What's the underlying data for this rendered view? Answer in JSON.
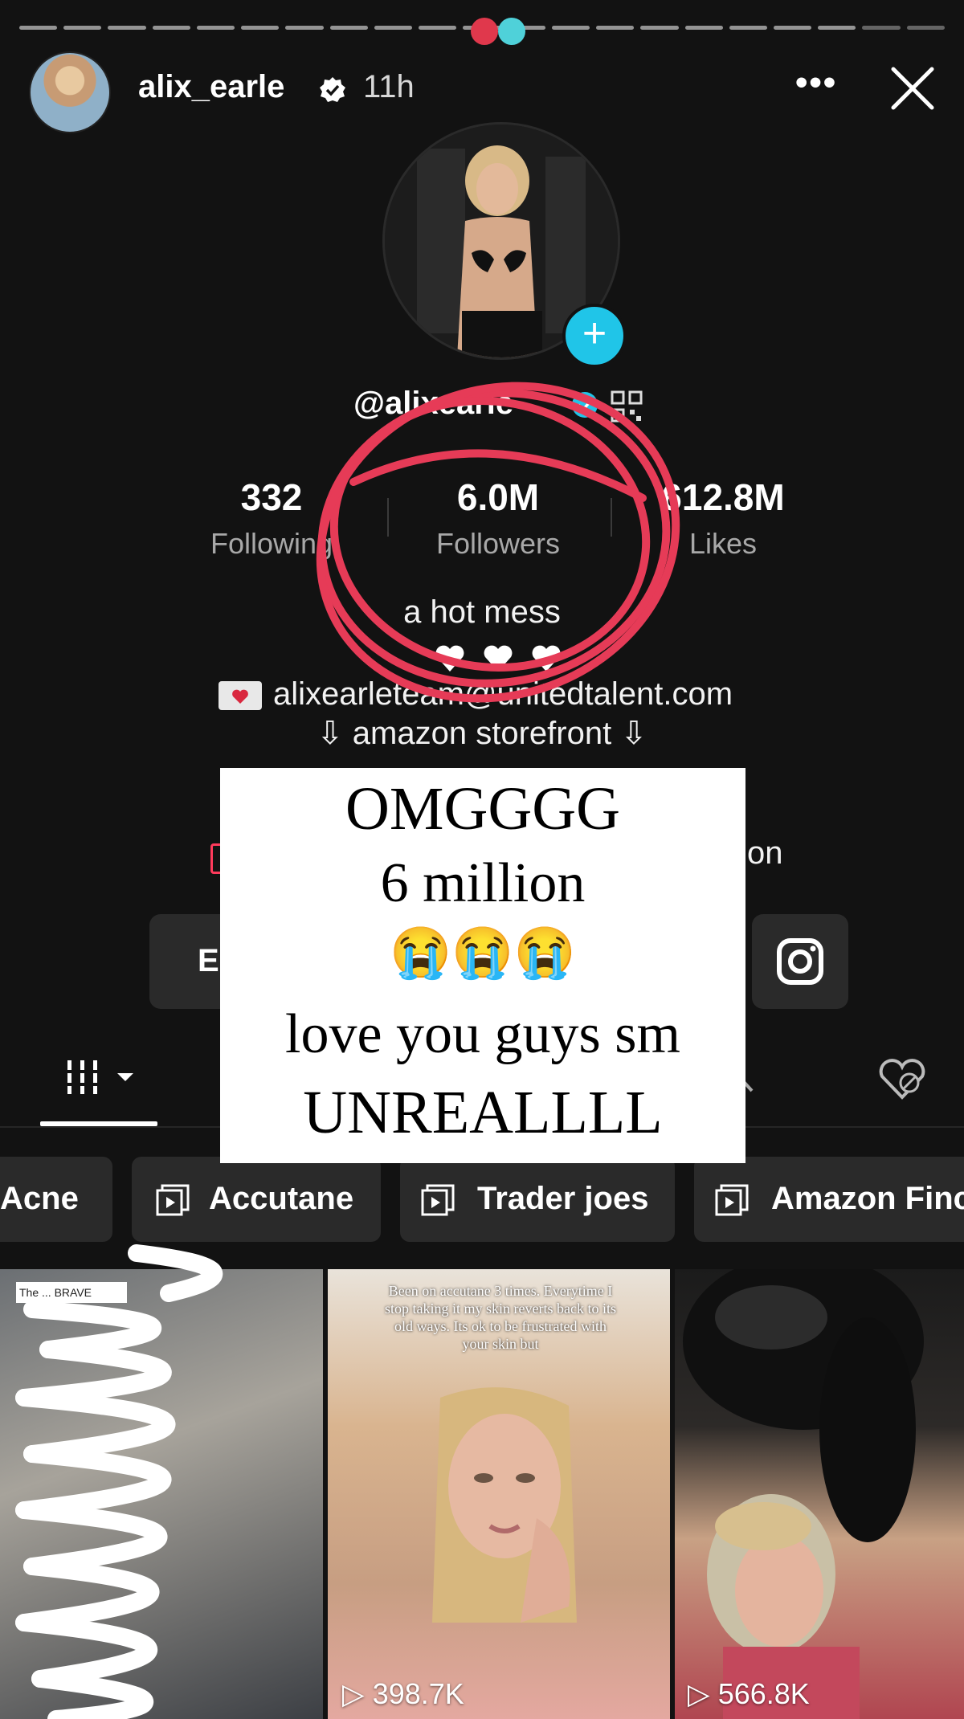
{
  "story": {
    "username": "alix_earle",
    "time_ago": "11h",
    "more_label": "•••",
    "segments": 21,
    "dot_colors": [
      "#e0384c",
      "#4fd1d9"
    ]
  },
  "profile": {
    "handle": "@alixearle",
    "stats": [
      {
        "value": "332",
        "label": "Following"
      },
      {
        "value": "6.0M",
        "label": "Followers"
      },
      {
        "value": "612.8M",
        "label": "Likes"
      }
    ],
    "bio_line": "a hot mess",
    "email": "alixearleteam@unitedtalent.com",
    "storefront": "⇩ amazon storefront ⇩",
    "link_fragment": "on",
    "edit_fragment": "E"
  },
  "sticker": {
    "lines": [
      "OMGGGG",
      "6 million",
      "😭😭😭",
      "love you guys sm",
      "UNREALLLL"
    ]
  },
  "tabs": {
    "icons": [
      "grid-icon",
      "dropdown-caret-icon",
      "repost-icon",
      "liked-hidden-icon"
    ]
  },
  "playlists": [
    {
      "label": "Acne"
    },
    {
      "label": "Accutane"
    },
    {
      "label": "Trader joes"
    },
    {
      "label": "Amazon Finc"
    }
  ],
  "videos": [
    {
      "caption": "",
      "views": ""
    },
    {
      "caption": "Been on accutane 3 times. Everytime I stop taking it my skin reverts back to its old ways. Its ok to be frustrated with your skin but",
      "views": "398.7K"
    },
    {
      "caption": "",
      "views": "566.8K"
    }
  ],
  "video1_note": "The ... BRAVE",
  "colors": {
    "background": "#121212",
    "accent_cyan": "#20c5e8",
    "annotation_red": "#e63b57",
    "chip_bg": "#2a2a2a"
  }
}
